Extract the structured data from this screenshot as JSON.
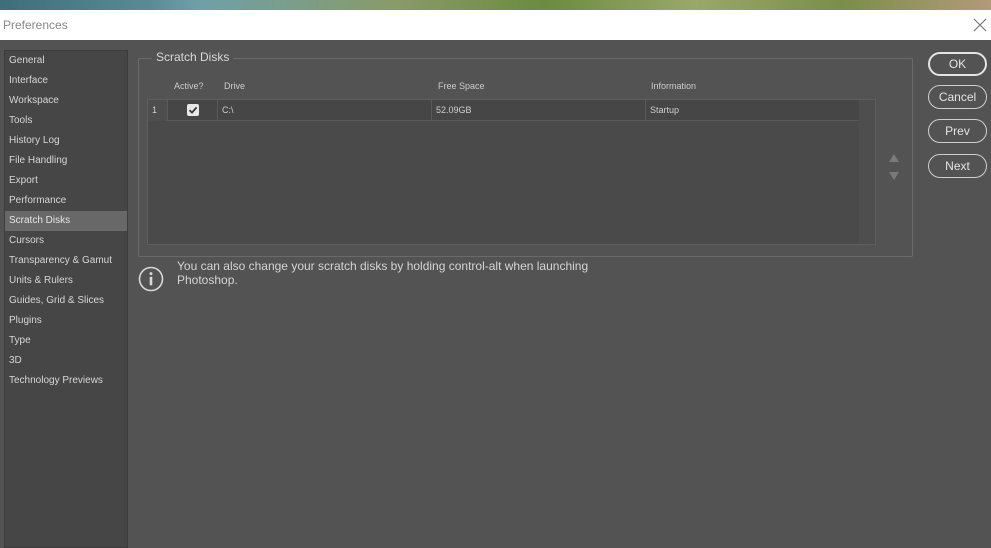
{
  "window": {
    "title": "Preferences",
    "close_icon": "close-icon"
  },
  "sidebar": {
    "items": [
      {
        "label": "General"
      },
      {
        "label": "Interface"
      },
      {
        "label": "Workspace"
      },
      {
        "label": "Tools"
      },
      {
        "label": "History Log"
      },
      {
        "label": "File Handling"
      },
      {
        "label": "Export"
      },
      {
        "label": "Performance"
      },
      {
        "label": "Scratch Disks",
        "active": true
      },
      {
        "label": "Cursors"
      },
      {
        "label": "Transparency & Gamut"
      },
      {
        "label": "Units & Rulers"
      },
      {
        "label": "Guides, Grid & Slices"
      },
      {
        "label": "Plugins"
      },
      {
        "label": "Type"
      },
      {
        "label": "3D"
      },
      {
        "label": "Technology Previews"
      }
    ]
  },
  "scratch_disks": {
    "title": "Scratch Disks",
    "columns": {
      "active": "Active?",
      "drive": "Drive",
      "free_space": "Free Space",
      "information": "Information"
    },
    "rows": [
      {
        "num": "1",
        "active": true,
        "drive": "C:\\",
        "free_space": "52.09GB",
        "information": "Startup"
      }
    ]
  },
  "note": "You can also change your scratch disks by holding control-alt when launching Photoshop.",
  "buttons": {
    "ok": "OK",
    "cancel": "Cancel",
    "prev": "Prev",
    "next": "Next"
  },
  "colors": {
    "background": "#535353",
    "sidebar": "#464646",
    "sidebar_active": "#686868",
    "titlebar": "#ffffff"
  }
}
